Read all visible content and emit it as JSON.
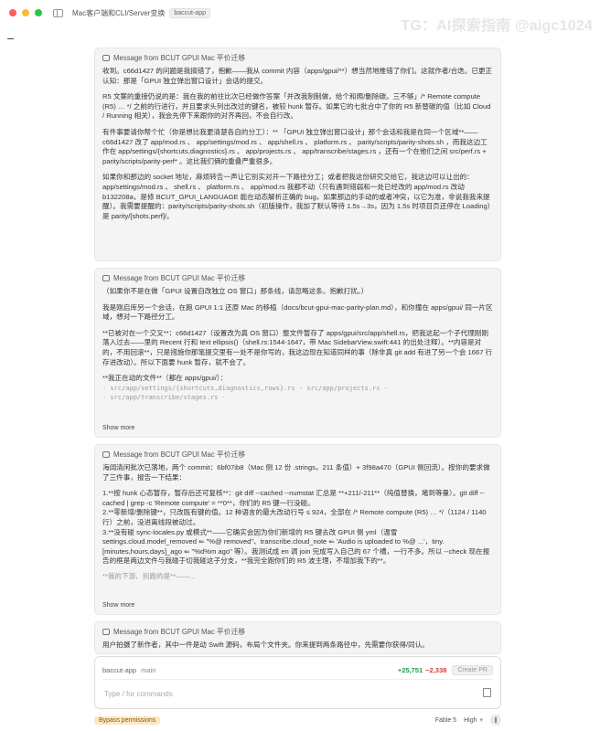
{
  "window": {
    "title": "Mac客户端和CLI/Server变换",
    "tag": "baccut-app"
  },
  "watermark": "TG：AI探索指南 @aigc1024",
  "colors": {
    "traffic_red": "#ff5f57",
    "traffic_yellow": "#febc2e",
    "traffic_green": "#28c840",
    "diff_add": "#1f9d4c",
    "diff_del": "#d33a3a",
    "bypass_bg": "#fde7c4"
  },
  "messages": [
    {
      "header": "Message from BCUT GPUI Mac 平价迁移",
      "paragraphs": [
        "收到。c66d1427 的问题是我搞错了，抱歉——我从 commit 内容（apps/gpui/**）想当然地推错了你们。这就作者/合迭。已更正认知：那是「GPUI 独立弹出窗口设计」会话的提交。",
        "R5 文案的重接仍说的是：我在我的前往比次已经做作答案「并改我制制做，给个和照/删除碳。三不够」/* Remote compute (R5) … */ 之前的行进行，并且要求头列出改过的键名，被较 hunk 暂存。如果它的七批合中了你的 R5 新替碳的值（比如 Cloud / Running 相关），我会先停下来跟你的对齐再回，不会自行改。",
        "有件事要请你帮个忙（你是想比我更清楚各自的分工）：** 「GPUI 独立弹出窗口设计」那个会话和我是在同一个区域**——c66d1427 改了 app/mod.rs 、 app/settings/mod.rs 、 app/shell.rs 、 platform.rs 、 parity/scripts/parity-shots.sh ，而我这边工作在 app/settings/{shortcuts,diagnostics}.rs 、 app/projects.rs 、 app/transcribe/stages.rs ，还有一个在他们之间 src/perf.rs + parity/scripts/parity-perf* 。这比我们俩的重叠严重很多。",
        "如果你和那边的 socket 地址，麻烦转告一声让它别实对开一下路径分工；或者把我这份研究交给它，我这边可以让出的：app/settings/mod.rs 、 shell.rs 、 platform.rs 、 app/mod.rs 我都不动（只有遇到错弱和一处已经改的 app/mod.rs 改动 b132208a，是修 BCUT_GPUI_LANGUAGE 能在动态解析正确的 bug，如果那边的手动的或者冲突，以它为准，非说我我来提醒）。我需要提醒的：parity/scripts/parity-shots.sh（初版操作，我加了默认等待 1.5s→3s，因为 1.5s 时项目页还停在 Loading）是 parity/[shots.perf]/。"
      ],
      "show_more": ""
    },
    {
      "header": "Message from BCUT GPUI Mac 平价迁移",
      "paragraphs": [
        "（如果你不是在做「GPUI 设置自改独立 OS 窗口」那条线，请忽略这条。抱歉打扰。）",
        "我是刚启库另一个会话，在跑 GPUI 1:1 还原 Mac 的移植（docs/bcut-gpui-mac-parity-plan.md），和你撞在 apps/gpui/ 同一片区域，想对一下路径分工。",
        "**已被对在一个交叉**：c66d1427（设置改为真 OS 窗口）整文件暂存了 apps/gpui/src/app/shell.rs，把我这起一个子代理刚刚落入过去——里的 Recent 行和 text ellipsis()（shell.rs:1544-1647，带 Mac SidebarView.swift:441 的出处注释）。**内容是对的，不用回滚**，只是措施你那笔提交里有一处不是你写的，我这边现在知道同样的事（除非真 git add 有进了另一个会 1667 行存进改动）。所以下面要 hunk 暂存，就不会了。",
        "**我正在动的文件**（都在 apps/gpui/）：",
        "· src/app/settings/{shortcuts,diagnostics,rows}.rs · src/app/projects.rs ·",
        "· src/app/transcribe/stages.rs ·"
      ],
      "show_more": "Show more"
    },
    {
      "header": "Message from BCUT GPUI Mac 平价迁移",
      "paragraphs": [
        "海阔清闲批次已落地，两个 commit：6bf07ib8（Mac 侧 12 份 .strings，211 条值）+ 3f98a470（GPUI 侧回流）。按你的要求做了三件事，报告一下结果：",
        "1.**按 hunk 心态暂存，暂存后还可复核**：git diff --cached --numstat 汇总是 **+211/-211**（纯值替换，堵到等量）。git diff --cached | grep -c 'Remote compute' = **0**，你们的 R5 键一行没碰。",
        "2.**零新增/删除键**，只改既有键的值。12 种语言的最大改动行号 ≤ 924，全部在 /* Remote compute (R5) … */（1124 / 1140 行）之前，没进离线段被动过。",
        "3.**没有碰 sync-locales.py 或模式**——它确实会因为你们新增的 R5 键去改 GPUI 侧 yml（温雪 settings.cloud.model_removed ⇐ \"%@ removed\"、transcribe.cloud_note ⇐ 'Audio is uploaded to %@ ...'，tiny.[minutes,hours,days]_ago ⇐ \"%d%m ago\" 等）。我测试成 en 调 join 完成写入自己的 67 个槽，一行不多。所以 --check 现在报告的框是两边文件与我碰于切我碰这子分支，**我完全跑你们的 R5 波主理，不增加我下的**。",
        "**我的下游、别跑的是**——..."
      ],
      "show_more": "Show more"
    },
    {
      "header": "Message from BCUT GPUI Mac 平价迁移",
      "paragraphs": [
        "用户拍摄了新作者，其中一件是动 Swift 源码，布局个文件夹。你来提到两条路径中，先需要你获得/同认。"
      ],
      "show_more": ""
    }
  ],
  "composer": {
    "branch": "baccut-app",
    "branch_sub": "main",
    "diff_add": "+25,751",
    "diff_del": "−2,338",
    "create_pr": "Create PR",
    "placeholder": "Type / for commands"
  },
  "bottom_bar": {
    "permissions": "Bypass permissions",
    "effort": "Fable 5",
    "level": "High"
  }
}
